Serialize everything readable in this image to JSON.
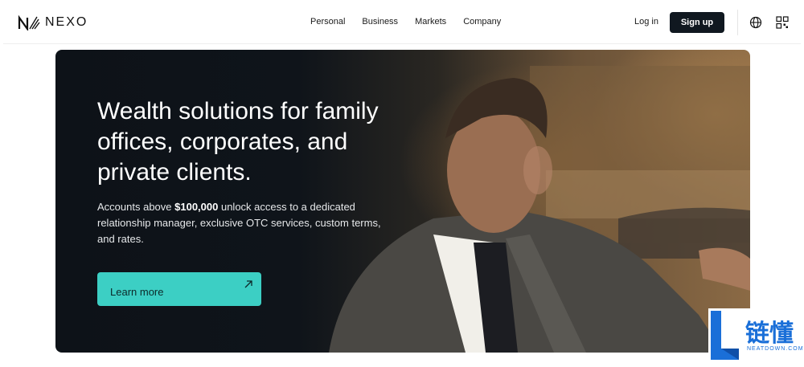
{
  "header": {
    "brand": "NEXO",
    "nav": [
      "Personal",
      "Business",
      "Markets",
      "Company"
    ],
    "login_label": "Log in",
    "signup_label": "Sign up",
    "icons": [
      "globe-icon",
      "qr-code-icon"
    ]
  },
  "hero": {
    "title": "Wealth solutions for family offices, corporates, and private clients.",
    "subtitle_pre": "Accounts above ",
    "subtitle_amount": "$100,000",
    "subtitle_post": " unlock access to a dedicated relationship manager, exclusive OTC services, custom terms, and rates.",
    "cta_label": "Learn more",
    "accent_color": "#3ccfc4"
  },
  "watermark": {
    "text": "链懂",
    "small": "NEATDOWN.COM"
  }
}
